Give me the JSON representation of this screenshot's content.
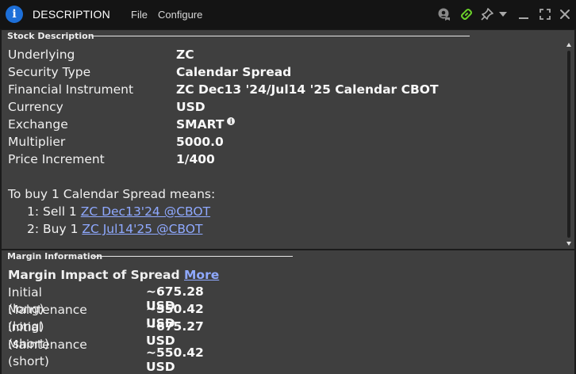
{
  "titlebar": {
    "logo": "i",
    "title": "DESCRIPTION",
    "menu": [
      "File",
      "Configure"
    ],
    "icons": [
      "chat-icon",
      "link-icon",
      "pin-icon",
      "dropdown-icon",
      "minimize-icon",
      "maximize-icon",
      "close-icon"
    ],
    "link_color": "#6bd12a"
  },
  "stock": {
    "header": "Stock Description",
    "rows": [
      {
        "label": "Underlying",
        "value": "ZC"
      },
      {
        "label": "Security Type",
        "value": "Calendar Spread"
      },
      {
        "label": "Financial Instrument",
        "value": "ZC Dec13 '24/Jul14 '25 Calendar CBOT"
      },
      {
        "label": "Currency",
        "value": "USD"
      },
      {
        "label": "Exchange",
        "value": "SMART"
      },
      {
        "label": "Multiplier",
        "value": "5000.0"
      },
      {
        "label": "Price Increment",
        "value": "1/400"
      }
    ],
    "buy_title": "To buy 1 Calendar Spread means:",
    "legs": [
      {
        "prefix": "1: Sell 1 ",
        "link": "ZC Dec13'24 @CBOT"
      },
      {
        "prefix": "2: Buy 1 ",
        "link": "ZC Jul14'25 @CBOT"
      }
    ]
  },
  "margin": {
    "header": "Margin Information",
    "impact_title": "Margin Impact of Spread",
    "more_link": "More",
    "rows": [
      {
        "label": "Initial (long)",
        "value": "~675.28 USD"
      },
      {
        "label": "Maintenance (long)",
        "value": "~550.42 USD"
      },
      {
        "label": "Initial (short)",
        "value": "~675.27 USD"
      },
      {
        "label": "Maintenance (short)",
        "value": "~550.42 USD"
      }
    ]
  },
  "colors": {
    "background": "#1b1b1b",
    "panel": "#3f3f3f",
    "link": "#8fa9ff",
    "logo": "#1d6fd8"
  }
}
